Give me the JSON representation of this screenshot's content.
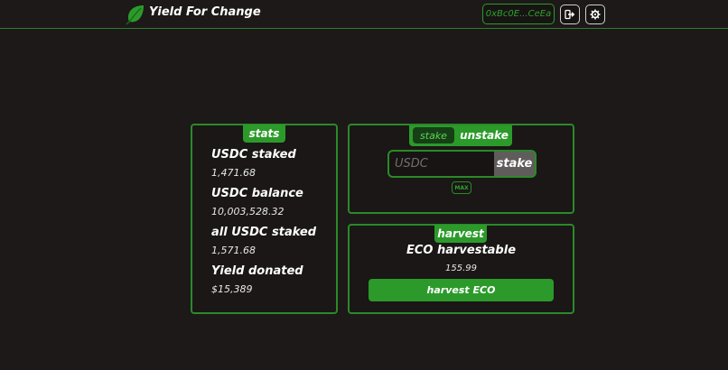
{
  "header": {
    "app_title": "Yield For Change",
    "logo_icon": "leaf-icon",
    "wallet_address": "0xBc0E...CeEa",
    "logout_icon": "logout-icon",
    "settings_icon": "gear-icon"
  },
  "stats": {
    "tab_label": "stats",
    "items": [
      {
        "label": "USDC staked",
        "value": "1,471.68"
      },
      {
        "label": "USDC balance",
        "value": "10,003,528.32"
      },
      {
        "label": "all USDC staked",
        "value": "1,571.68"
      },
      {
        "label": "Yield donated",
        "value": "$15,389"
      }
    ]
  },
  "stake_panel": {
    "stake_tab": "stake",
    "unstake_tab": "unstake",
    "input_placeholder": "USDC",
    "stake_button": "stake",
    "max_button": "MAX"
  },
  "harvest": {
    "tab_label": "harvest",
    "label": "ECO harvestable",
    "value": "155.99",
    "button": "harvest ECO"
  },
  "colors": {
    "accent": "#2c9a2a",
    "background": "#1c1918"
  }
}
